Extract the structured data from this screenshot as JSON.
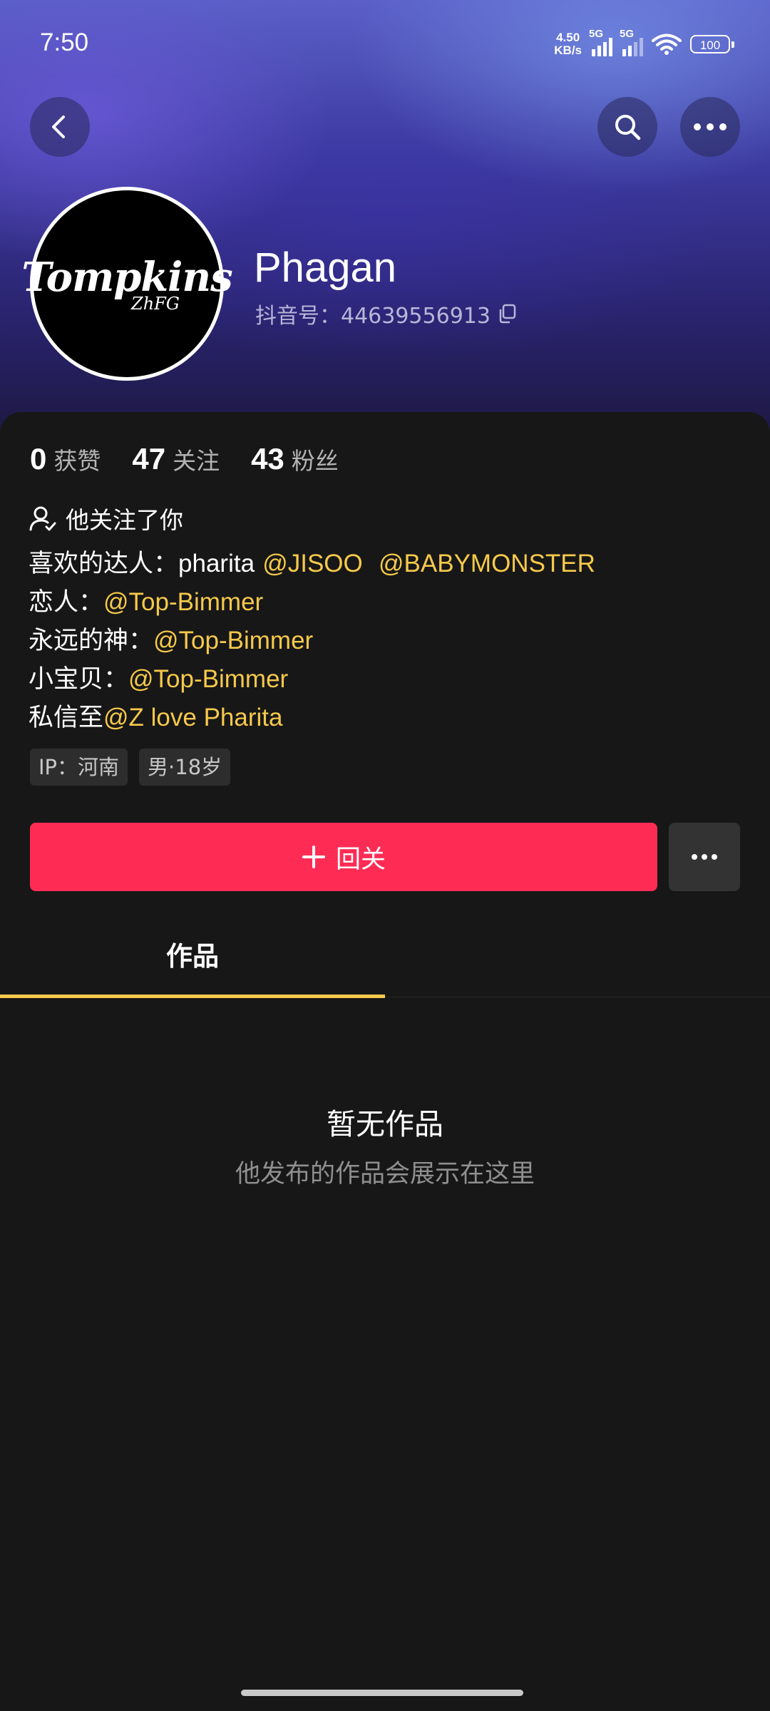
{
  "status_bar": {
    "time": "7:50",
    "net_speed_value": "4.50",
    "net_speed_unit": "KB/s",
    "sim1_label": "5G",
    "sim2_label": "5G",
    "battery": "100"
  },
  "header": {
    "name": "Phagan",
    "douyin_id": "抖音号：44639556913",
    "avatar_logo_text": "Tompkins",
    "avatar_logo_sub": "ZhFG"
  },
  "stats": {
    "likes_count": "0",
    "likes_label": "获赞",
    "following_count": "47",
    "following_label": "关注",
    "followers_count": "43",
    "followers_label": "粉丝"
  },
  "follows_you": "他关注了你",
  "bio": {
    "line1_prefix": "喜欢的达人：",
    "line1_name": "pharita",
    "line1_mention1": "@JISOO",
    "line1_mention2": "@BABYMONSTER",
    "line2_prefix": "恋人：",
    "line2_mention": "@Top-Bimmer",
    "line3_prefix": "永远的神：",
    "line3_mention": "@Top-Bimmer",
    "line4_prefix": "小宝贝：",
    "line4_mention": "@Top-Bimmer",
    "line5_prefix": "私信至",
    "line5_mention": "@Z love Pharita"
  },
  "tags": {
    "ip": "IP：河南",
    "gender_age": "男·18岁"
  },
  "actions": {
    "follow_back_label": "回关"
  },
  "tabs": {
    "works": "作品"
  },
  "empty_state": {
    "title": "暂无作品",
    "subtitle": "他发布的作品会展示在这里"
  },
  "icons": {
    "back": "chevron-left-icon",
    "search": "search-icon",
    "more": "more-horizontal-icon",
    "copy": "copy-icon",
    "user": "user-check-icon",
    "plus": "plus-icon"
  },
  "colors": {
    "accent_red": "#fe2c55",
    "mention_yellow": "#f6c94b",
    "background": "#171717"
  }
}
